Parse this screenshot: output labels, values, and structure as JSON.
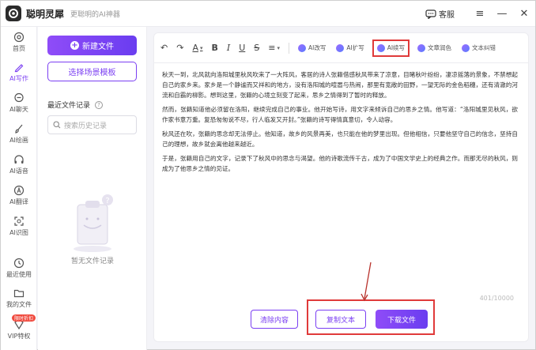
{
  "app": {
    "title": "聪明灵犀",
    "subtitle": "更聪明的AI神器",
    "service_label": "客服"
  },
  "window_controls": [
    "≡",
    "—",
    "✕"
  ],
  "rail": {
    "items": [
      {
        "label": "首页",
        "icon": "home-icon"
      },
      {
        "label": "AI写作",
        "icon": "pen-icon",
        "active": true
      },
      {
        "label": "AI聊天",
        "icon": "chat-icon"
      },
      {
        "label": "AI绘画",
        "icon": "brush-icon"
      },
      {
        "label": "AI语音",
        "icon": "headphone-icon"
      },
      {
        "label": "AI翻译",
        "icon": "translate-icon"
      },
      {
        "label": "AI识图",
        "icon": "scan-icon"
      },
      {
        "label": "最近使用",
        "icon": "clock-icon"
      },
      {
        "label": "我的文件",
        "icon": "folder-icon"
      },
      {
        "label": "VIP特权",
        "icon": "vip-icon",
        "badge": "限时折扣"
      }
    ]
  },
  "panel": {
    "new_file": "新建文件",
    "choose_template": "选择场景模板",
    "recent_title": "最近文件记录",
    "search_placeholder": "搜索历史记录",
    "empty_text": "暂无文件记录"
  },
  "toolbar": {
    "undo": "↶",
    "redo": "↷",
    "font_color": "A",
    "bold": "B",
    "italic": "I",
    "underline": "U",
    "strike": "S",
    "align": "≡",
    "ai_tools": [
      {
        "label": "AI改写",
        "highlighted": false
      },
      {
        "label": "AI扩写",
        "highlighted": false
      },
      {
        "label": "AI续写",
        "highlighted": true
      },
      {
        "label": "文章润色",
        "highlighted": false
      },
      {
        "label": "文本纠错",
        "highlighted": false
      }
    ]
  },
  "editor": {
    "paragraphs": [
      "秋天一到，北风就向洛阳城里秋风吹来了一大阵风，客居的诗人张籍借感秋风带来了凉意，目睹秋叶纷纷，凄凉摇落的景象，不禁想起自己的家乡来。家乡是一个静谧而又祥和的地方，没有洛阳城的喧嚣与热闹，那里有宽敞的田野，一望无际的金色稻穗，还有清澈的河流和自霸的柳影。想到这里，张籍的心境立刻变了起来，思乡之情得到了暂时的释放。",
      "然而，张籍知道他必须留在洛阳，继续完成自己的事业。他开始写诗，用文字来倾诉自己的思乡之情。他写道：“洛阳城里见秋风，欲作家书意万重。复恐匆匆说不尽，行人临发又开封。”张籍的诗写得情真意切，令人动容。",
      "秋风还在吹，张籍的思念却无法停止。他知道，故乡的风景再美，也只能在他的梦里出现。但他相信，只要他坚守自己的信念，坚持自己的理想，故乡就会离他越来越近。",
      "于是，张籍用自己的文字，记录下了秋风中的思念与渴望。他的诗歌流传千古，成为了中国文学史上的经典之作。而那无尽的秋风，则成为了他思乡之情的见证。"
    ],
    "counter": "401/10000",
    "clear_label": "清除内容",
    "copy_label": "复制文本",
    "download_label": "下载文件"
  },
  "colors": {
    "accent": "#7b3ff2",
    "highlight": "#e03a3a"
  }
}
